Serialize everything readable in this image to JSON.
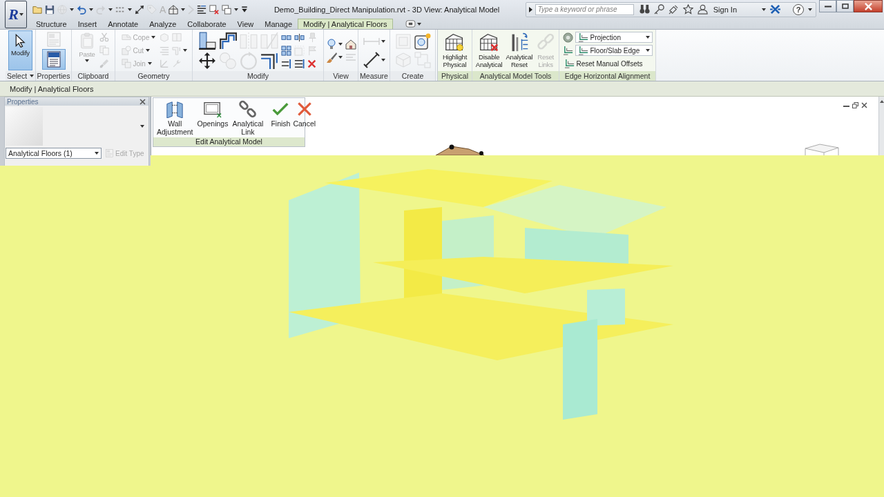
{
  "app_button": {
    "glyph": "R"
  },
  "quick_access": [
    {
      "disabled": false,
      "menu": false
    },
    {
      "disabled": false,
      "menu": false
    },
    {
      "disabled": true,
      "menu": true
    },
    {
      "disabled": false,
      "menu": true
    },
    {
      "disabled": true,
      "menu": true
    },
    {
      "disabled": false,
      "menu": true
    },
    {
      "disabled": false,
      "menu": false
    },
    {
      "disabled": true,
      "menu": false
    },
    {
      "glyph": "A",
      "disabled": true,
      "menu": false
    },
    {
      "disabled": false,
      "menu": true
    },
    {
      "disabled": true,
      "menu": false
    },
    {
      "disabled": false,
      "menu": false
    },
    {
      "disabled": false,
      "menu": false
    },
    {
      "disabled": false,
      "menu": true
    },
    {
      "disabled": false,
      "menu": false
    }
  ],
  "title": "Demo_Building_Direct Manipulation.rvt - 3D View: Analytical Model",
  "search": {
    "placeholder": "Type a keyword or phrase"
  },
  "sign_in": {
    "label": "Sign In"
  },
  "help": {
    "glyph": "?"
  },
  "ribbon_tabs": [
    {
      "label": "Structure",
      "selected": false
    },
    {
      "label": "Insert",
      "selected": false
    },
    {
      "label": "Annotate",
      "selected": false
    },
    {
      "label": "Analyze",
      "selected": false
    },
    {
      "label": "Collaborate",
      "selected": false
    },
    {
      "label": "View",
      "selected": false
    },
    {
      "label": "Manage",
      "selected": false
    },
    {
      "label": "Modify | Analytical Floors",
      "selected": true
    }
  ],
  "ribbon_panels": [
    {
      "title": "Select",
      "contextual": false,
      "has_menu": true,
      "tools": [
        {
          "kind": "large",
          "label": "Modify",
          "selected": true,
          "disabled": false,
          "menu": false
        }
      ]
    },
    {
      "title": "Properties",
      "contextual": false,
      "has_menu": false,
      "tools": [
        {
          "kind": "button",
          "selected": false,
          "disabled": true,
          "menu": false
        },
        {
          "kind": "button",
          "selected": true,
          "disabled": false,
          "menu": false
        }
      ]
    },
    {
      "title": "Clipboard",
      "contextual": false,
      "has_menu": false,
      "tools": [
        {
          "kind": "large",
          "label": "Paste",
          "disabled": true,
          "menu": true
        },
        {
          "kind": "icon",
          "disabled": true,
          "menu": false
        },
        {
          "kind": "icon",
          "disabled": true,
          "menu": false
        },
        {
          "kind": "icon",
          "disabled": true,
          "menu": false
        }
      ]
    },
    {
      "title": "Geometry",
      "contextual": false,
      "has_menu": false,
      "tools": [
        {
          "kind": "small",
          "label": "Cope",
          "disabled": true,
          "menu": true
        },
        {
          "kind": "small",
          "label": "Cut",
          "disabled": true,
          "menu": true
        },
        {
          "kind": "small",
          "label": "Join",
          "disabled": true,
          "menu": true
        },
        {
          "kind": "icon",
          "disabled": true,
          "menu": false
        },
        {
          "kind": "icon",
          "disabled": true,
          "menu": false
        },
        {
          "kind": "icon",
          "disabled": true,
          "menu": false
        },
        {
          "kind": "icon",
          "disabled": true,
          "menu": false
        },
        {
          "kind": "icon",
          "disabled": true,
          "menu": true
        },
        {
          "kind": "icon",
          "disabled": true,
          "menu": false
        }
      ]
    },
    {
      "title": "Modify",
      "contextual": false,
      "has_menu": false,
      "tools": [
        {
          "kind": "button",
          "disabled": false,
          "menu": false
        },
        {
          "kind": "button",
          "disabled": false,
          "menu": false
        },
        {
          "kind": "button",
          "disabled": false,
          "menu": false
        },
        {
          "kind": "button",
          "disabled": true,
          "menu": false
        },
        {
          "kind": "button",
          "disabled": true,
          "menu": false
        },
        {
          "kind": "button",
          "disabled": true,
          "menu": false
        },
        {
          "kind": "button",
          "disabled": true,
          "menu": false
        },
        {
          "kind": "button",
          "disabled": false,
          "menu": false
        },
        {
          "kind": "icon",
          "disabled": false,
          "menu": false
        },
        {
          "kind": "icon",
          "disabled": false,
          "menu": false
        },
        {
          "kind": "icon",
          "disabled": false,
          "menu": false
        },
        {
          "kind": "icon",
          "disabled": false,
          "menu": false
        },
        {
          "kind": "icon",
          "disabled": true,
          "menu": false
        },
        {
          "kind": "icon",
          "disabled": false,
          "menu": false
        },
        {
          "kind": "icon",
          "disabled": true,
          "menu": false
        },
        {
          "kind": "icon",
          "disabled": true,
          "menu": false
        },
        {
          "kind": "icon",
          "disabled": false,
          "menu": false
        }
      ]
    },
    {
      "title": "View",
      "contextual": false,
      "has_menu": false,
      "tools": [
        {
          "kind": "button",
          "disabled": false,
          "menu": true
        },
        {
          "kind": "button",
          "disabled": false,
          "menu": true
        },
        {
          "kind": "button",
          "disabled": false,
          "menu": false
        },
        {
          "kind": "button",
          "disabled": true,
          "menu": false
        }
      ]
    },
    {
      "title": "Measure",
      "contextual": false,
      "has_menu": false,
      "tools": [
        {
          "kind": "button",
          "disabled": true,
          "menu": true
        },
        {
          "kind": "button",
          "disabled": false,
          "menu": true
        }
      ]
    },
    {
      "title": "Create",
      "contextual": false,
      "has_menu": false,
      "tools": [
        {
          "kind": "button",
          "disabled": true,
          "menu": false
        },
        {
          "kind": "button",
          "disabled": true,
          "menu": false
        },
        {
          "kind": "button",
          "disabled": false,
          "menu": false
        },
        {
          "kind": "button",
          "disabled": true,
          "menu": false
        }
      ]
    },
    {
      "title": "Physical",
      "contextual": true,
      "has_menu": false,
      "tools": [
        {
          "kind": "large",
          "label": "Highlight Physical",
          "disabled": false,
          "menu": false
        }
      ]
    },
    {
      "title": "Analytical Model Tools",
      "contextual": true,
      "has_menu": false,
      "tools": [
        {
          "kind": "large",
          "label": "Disable Analytical",
          "disabled": false,
          "menu": false
        },
        {
          "kind": "large",
          "label": "Analytical Reset",
          "disabled": false,
          "menu": false
        },
        {
          "kind": "large",
          "label": "Reset Links",
          "disabled": true,
          "menu": false
        }
      ]
    },
    {
      "title": "Edge Horizontal Alignment",
      "contextual": true,
      "has_menu": false,
      "tools": [
        {
          "kind": "icon",
          "disabled": false,
          "menu": false
        },
        {
          "kind": "combo",
          "label": "Projection",
          "disabled": false,
          "menu": true
        },
        {
          "kind": "icon",
          "disabled": false,
          "menu": false
        },
        {
          "kind": "combo",
          "label": "Floor/Slab Edge",
          "disabled": false,
          "menu": true
        },
        {
          "kind": "small",
          "label": "Reset Manual Offsets",
          "disabled": false,
          "menu": false
        }
      ]
    }
  ],
  "options_bar": {
    "label": "Modify | Analytical Floors"
  },
  "properties": {
    "title": "Properties",
    "type_selector": "Analytical Floors (1)",
    "edit_type": {
      "label": "Edit Type",
      "disabled": true
    }
  },
  "edit_panel": {
    "title": "Edit Analytical Model",
    "tools": [
      {
        "kind": "tool",
        "label": "Wall Adjustment"
      },
      {
        "kind": "tool",
        "label": "Openings"
      },
      {
        "kind": "tool",
        "label": "Analytical Link"
      },
      {
        "kind": "mode",
        "label": "Finish"
      },
      {
        "kind": "mode",
        "label": "Cancel"
      }
    ]
  }
}
